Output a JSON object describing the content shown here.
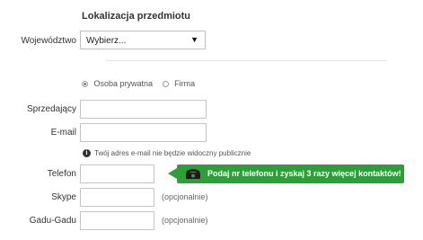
{
  "section_title": "Lokalizacja przedmiotu",
  "voivodeship": {
    "label": "Województwo",
    "value": "Wybierz..."
  },
  "seller_type": {
    "options": [
      {
        "label": "Osoba prywatna",
        "checked": true
      },
      {
        "label": "Firma",
        "checked": false
      }
    ]
  },
  "fields": {
    "seller": {
      "label": "Sprzedający",
      "value": ""
    },
    "email": {
      "label": "E-mail",
      "value": "",
      "hint": "Twój adres e-mail nie będzie widoczny publicznie"
    },
    "phone": {
      "label": "Telefon",
      "value": ""
    },
    "skype": {
      "label": "Skype",
      "value": "",
      "optional": "(opcjonalnie)"
    },
    "gadugadu": {
      "label": "Gadu-Gadu",
      "value": "",
      "optional": "(opcjonalnie)"
    }
  },
  "promo": {
    "text": "Podaj nr telefonu i zyskaj 3 razy więcej kontaktów!",
    "color": "#2e9e3a",
    "icon": "telephone-icon"
  }
}
